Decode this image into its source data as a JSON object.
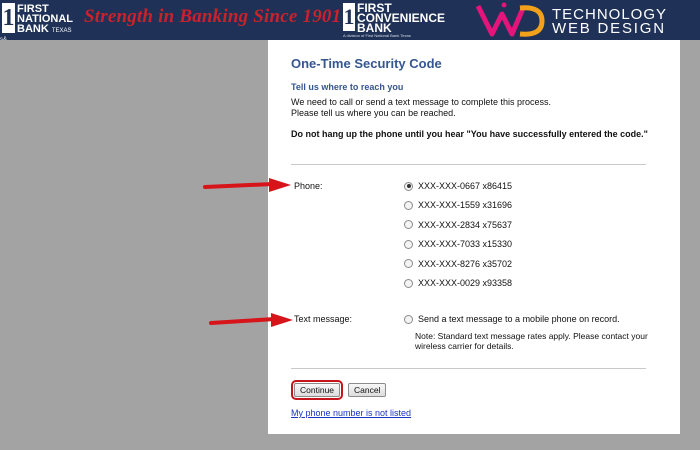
{
  "banner": {
    "left_logo": {
      "numeral": "1",
      "name": "FIRST\nNATIONAL\nBANK",
      "state": "TEXAS"
    },
    "stripe_text": "s&",
    "tagline": "Strength in Banking Since 1901",
    "mid_logo": {
      "numeral": "1",
      "name": "FIRST\nCONVENIENCE\nBANK",
      "sub": "A division of First National Bank Texas"
    },
    "web_design_logo": {
      "line1": "TECHNOLOGY",
      "line2": "WEB DESIGN"
    },
    "colors": {
      "banner_bg": "#1f3157",
      "tagline": "#c8222b"
    }
  },
  "dialog": {
    "title": "One-Time Security Code",
    "subtitle": "Tell us where to reach you",
    "intro_line1": "We need to call or send a text message to complete this process.",
    "intro_line2": "Please tell us where you can be reached.",
    "warning": "Do not hang up the phone until you hear \"You have successfully entered the code.\"",
    "phone_label": "Phone:",
    "phone_options": [
      {
        "label": "XXX-XXX-0667 x86415",
        "selected": true
      },
      {
        "label": "XXX-XXX-1559 x31696",
        "selected": false
      },
      {
        "label": "XXX-XXX-2834 x75637",
        "selected": false
      },
      {
        "label": "XXX-XXX-7033 x15330",
        "selected": false
      },
      {
        "label": "XXX-XXX-8276 x35702",
        "selected": false
      },
      {
        "label": "XXX-XXX-0029 x93358",
        "selected": false
      }
    ],
    "text_label": "Text message:",
    "text_option": {
      "label": "Send a text message to a mobile phone on record.",
      "selected": false
    },
    "note": "Note: Standard text message rates apply. Please contact your wireless carrier for details.",
    "continue_label": "Continue",
    "cancel_label": "Cancel",
    "unlisted_link": "My phone number is not listed",
    "colors": {
      "title": "#35568f",
      "link": "#1a34c4",
      "highlight": "#c4161c",
      "arrow": "#d7141a"
    }
  }
}
